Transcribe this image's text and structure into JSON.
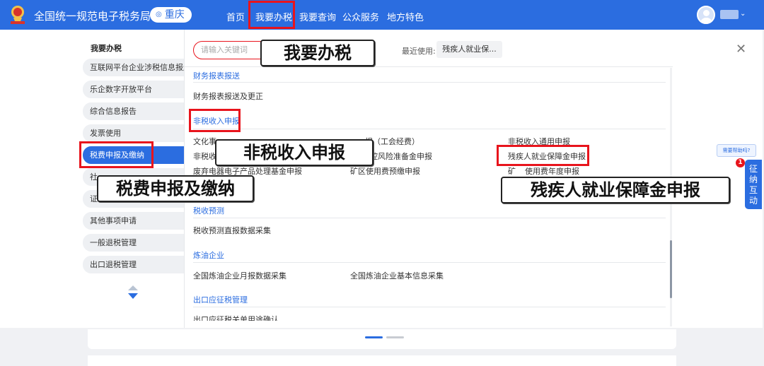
{
  "header": {
    "site_title": "全国统一规范电子税务局",
    "location": "重庆",
    "nav": [
      {
        "label": "首页"
      },
      {
        "label": "我要办税"
      },
      {
        "label": "我要查询"
      },
      {
        "label": "公众服务"
      },
      {
        "label": "地方特色"
      }
    ],
    "brand_color": "#2b6de0"
  },
  "sidebar": {
    "title": "我要办税",
    "items": [
      {
        "label": "互联网平台企业涉税信息报送"
      },
      {
        "label": "乐企数字开放平台"
      },
      {
        "label": "综合信息报告"
      },
      {
        "label": "发票使用"
      },
      {
        "label": "税费申报及缴纳",
        "active": true
      },
      {
        "label": "社"
      },
      {
        "label": "证"
      },
      {
        "label": "其他事项申请"
      },
      {
        "label": "一般退税管理"
      },
      {
        "label": "出口退税管理"
      }
    ]
  },
  "main": {
    "search_placeholder": "请输入关键词",
    "recent_label": "最近使用:",
    "recent_item": "残疾人就业保...",
    "close_icon": "close-icon",
    "categories": [
      {
        "title": "财务报表报送",
        "links": [
          "财务报表报送及更正"
        ]
      },
      {
        "title": "非税收入申报",
        "links": [
          "文化事",
          "报（工会经费）",
          "非税收入通用申报",
          "非税收",
          "控风险准备金申报",
          "残疾人就业保障金申报",
          "废弃电器电子产品处理基金申报",
          "矿区使用费预缴申报",
          "矿",
          "使用费年度申报"
        ]
      },
      {
        "title": "税收预测",
        "links": [
          "税收预测直报数据采集"
        ]
      },
      {
        "title": "炼油企业",
        "links": [
          "全国炼油企业月报数据采集",
          "全国炼油企业基本信息采集"
        ]
      },
      {
        "title": "出口应征税管理",
        "links": [
          "出口应征税关单用途确认"
        ]
      }
    ]
  },
  "callouts": {
    "woyaobanshui": "我要办税",
    "feishui": "非税收入申报",
    "shuifei": "税费申报及缴纳",
    "canji": "残疾人就业保障金申报"
  },
  "float": {
    "help": "需要帮助吗?",
    "interact_lines": [
      "征",
      "纳",
      "互",
      "动"
    ],
    "badge": "1"
  },
  "highlight_color": "#e8141c"
}
